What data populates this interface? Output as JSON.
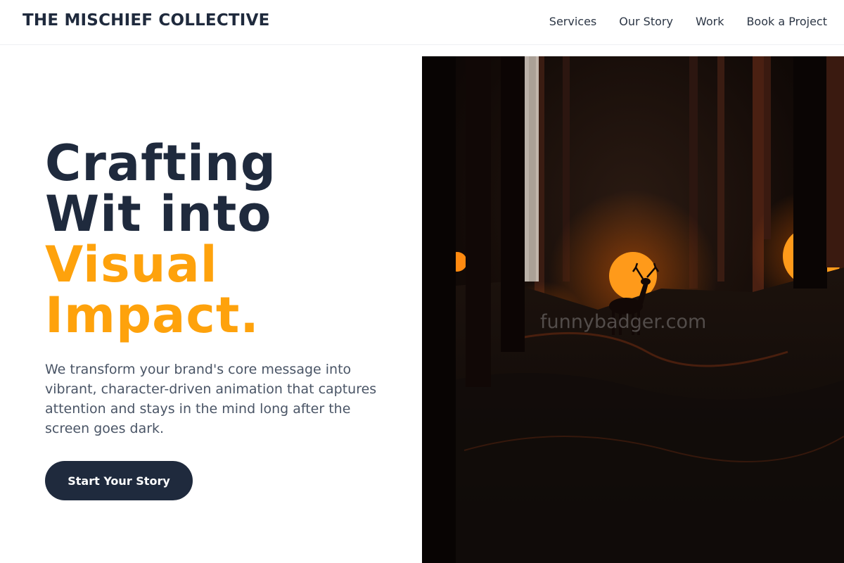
{
  "brand": {
    "name": "THE MISCHIEF COLLECTIVE"
  },
  "nav": {
    "items": [
      {
        "label": "Services"
      },
      {
        "label": "Our Story"
      },
      {
        "label": "Work"
      },
      {
        "label": "Book a Project"
      }
    ]
  },
  "hero": {
    "title_lines": [
      "Crafting",
      "Wit into"
    ],
    "title_accent_lines": [
      "Visual",
      "Impact."
    ],
    "description": "We transform your brand's core message into vibrant, character-driven animation that captures attention and stays in the mind long after the screen goes dark.",
    "cta_label": "Start Your Story",
    "image": {
      "watermark": "funnybadger.com",
      "icon": "forest-deer-image"
    }
  },
  "colors": {
    "brand_dark": "#1f2a3d",
    "accent": "#fea20c",
    "text_muted": "#4a5566",
    "moon_orange": "#ff9a1a"
  }
}
